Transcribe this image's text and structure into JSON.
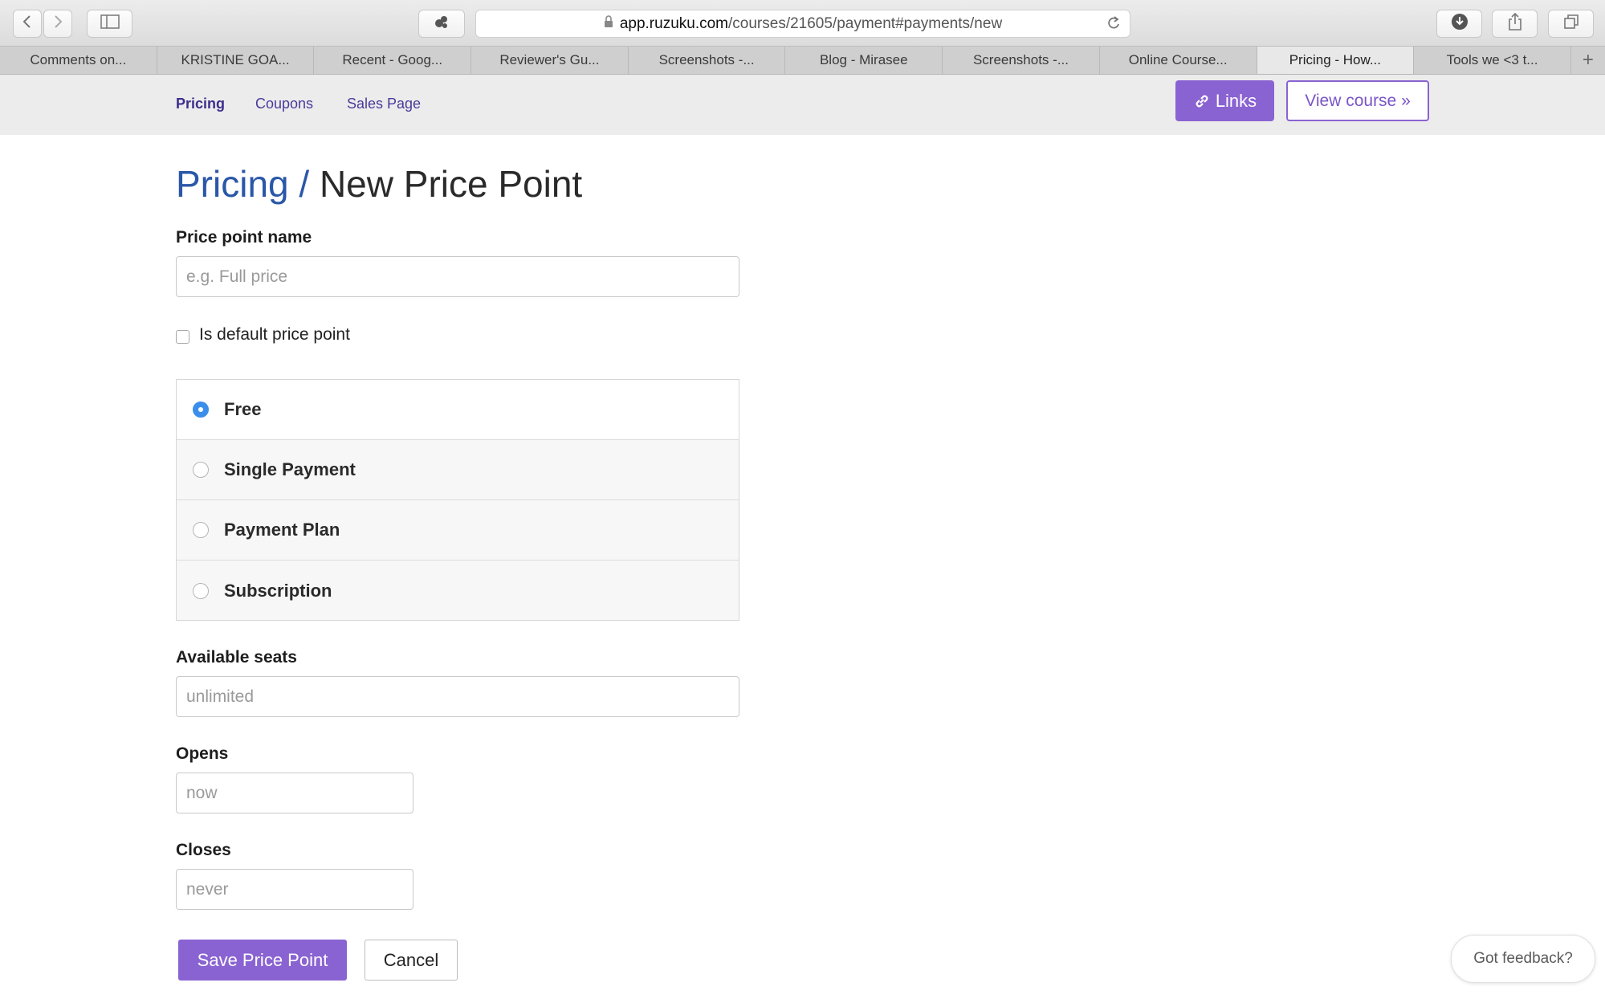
{
  "browser": {
    "url_host": "app.ruzuku.com",
    "url_path": "/courses/21605/payment#payments/new",
    "toolbar_icons": [
      "back-icon",
      "forward-icon",
      "sidebar-icon",
      "extension-icon",
      "lock-icon",
      "reload-icon",
      "download-icon",
      "share-icon",
      "tabs-icon"
    ],
    "tabs": [
      {
        "label": "Comments on..."
      },
      {
        "label": "KRISTINE GOA..."
      },
      {
        "label": "Recent - Goog..."
      },
      {
        "label": "Reviewer's Gu..."
      },
      {
        "label": "Screenshots -..."
      },
      {
        "label": "Blog - Mirasee"
      },
      {
        "label": "Screenshots -..."
      },
      {
        "label": "Online Course..."
      },
      {
        "label": "Pricing - How..."
      },
      {
        "label": "Tools we <3 t..."
      }
    ],
    "active_tab_index": 8,
    "new_tab_glyph": "+"
  },
  "subnav": {
    "items": [
      {
        "label": "Pricing"
      },
      {
        "label": "Coupons"
      },
      {
        "label": "Sales Page"
      }
    ],
    "active": "Pricing",
    "links_button": "Links",
    "view_course_button": "View course »"
  },
  "form": {
    "title_crumb": "Pricing /",
    "title_main": "New Price Point",
    "price_point_name": {
      "label": "Price point name",
      "placeholder": "e.g. Full price",
      "value": ""
    },
    "default_checkbox": {
      "label": "Is default price point",
      "checked": false
    },
    "payment_options": [
      {
        "label": "Free"
      },
      {
        "label": "Single Payment"
      },
      {
        "label": "Payment Plan"
      },
      {
        "label": "Subscription"
      }
    ],
    "selected_payment_option": "Free",
    "available_seats": {
      "label": "Available seats",
      "placeholder": "unlimited",
      "value": ""
    },
    "opens": {
      "label": "Opens",
      "placeholder": "now",
      "value": ""
    },
    "closes": {
      "label": "Closes",
      "placeholder": "never",
      "value": ""
    },
    "save_button": "Save Price Point",
    "cancel_button": "Cancel"
  },
  "feedback_button": "Got feedback?",
  "colors": {
    "accent": "#8a63d2",
    "title_link": "#2a57a8",
    "radio_selected": "#3b8fea"
  }
}
